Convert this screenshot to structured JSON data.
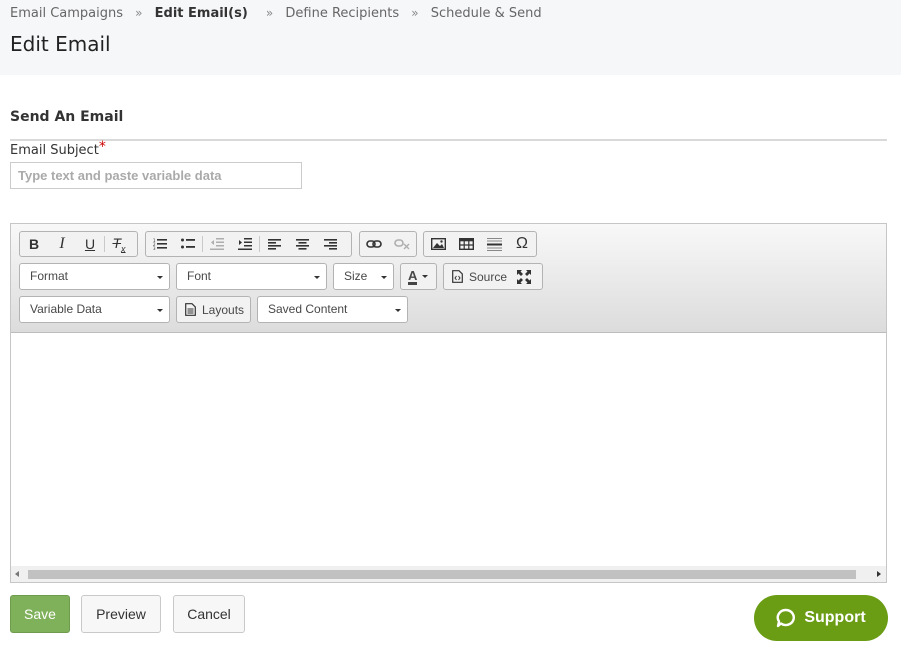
{
  "breadcrumb": {
    "items": [
      {
        "label": "Email Campaigns"
      },
      {
        "label": "Edit Email(s)"
      },
      {
        "label": "Define Recipients"
      },
      {
        "label": "Schedule & Send"
      }
    ],
    "separator": "»"
  },
  "page_title": "Edit Email",
  "section_title": "Send An Email",
  "subject": {
    "label": "Email Subject",
    "required_mark": "*",
    "placeholder": "Type text and paste variable data",
    "value": ""
  },
  "toolbar": {
    "bold_label": "B",
    "italic_label": "I",
    "underline_label": "U",
    "clear_format_label": "T",
    "clear_format_sub": "x",
    "special_char_label": "Ω",
    "format_label": "Format",
    "font_label": "Font",
    "size_label": "Size",
    "text_color_label": "A",
    "source_label": "Source",
    "variable_data_label": "Variable Data",
    "layouts_label": "Layouts",
    "saved_content_label": "Saved Content"
  },
  "actions": {
    "save_label": "Save",
    "preview_label": "Preview",
    "cancel_label": "Cancel",
    "support_label": "Support"
  },
  "colors": {
    "save_bg": "#7fb05a",
    "support_bg": "#6a9c14",
    "required": "#cc0000"
  }
}
